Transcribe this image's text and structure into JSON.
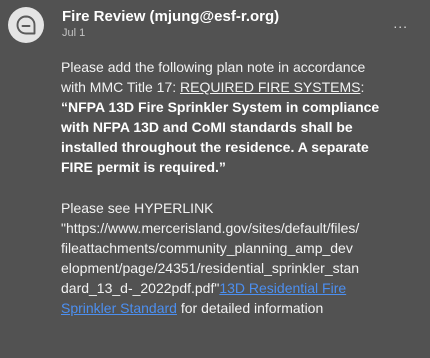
{
  "header": {
    "avatar_icon": "chat-bubble-icon",
    "sender": "Fire Review (mjung@esf-r.org)",
    "date": "Jul 1",
    "more_label": "..."
  },
  "message": {
    "para1_l1": "Please add the following plan note in accordance",
    "para1_l2_pre": "with MMC Title 17: ",
    "para1_l2_u": "REQUIRED FIRE SYSTEMS",
    "para1_l2_post": ":",
    "bold_l1": "“NFPA 13D Fire Sprinkler System in compliance",
    "bold_l2": "with NFPA 13D and CoMI standards shall be",
    "bold_l3": "installed throughout the residence.  A separate",
    "bold_l4": "FIRE permit is required.”",
    "para2_l1": "Please see HYPERLINK",
    "para2_l2": "\"https://www.mercerisland.gov/sites/default/files/",
    "para2_l3": "fileattachments/community_planning_amp_dev",
    "para2_l4": "elopment/page/24351/residential_sprinkler_stan",
    "para2_l5": "dard_13_d-_2022pdf.pdf\"",
    "link_l1": "13D Residential Fire",
    "link_l2": "Sprinkler Standard",
    "para2_tail": " for detailed information"
  },
  "colors": {
    "background": "#525252",
    "link": "#4c8ff0",
    "avatar": "#e4e4e4"
  }
}
